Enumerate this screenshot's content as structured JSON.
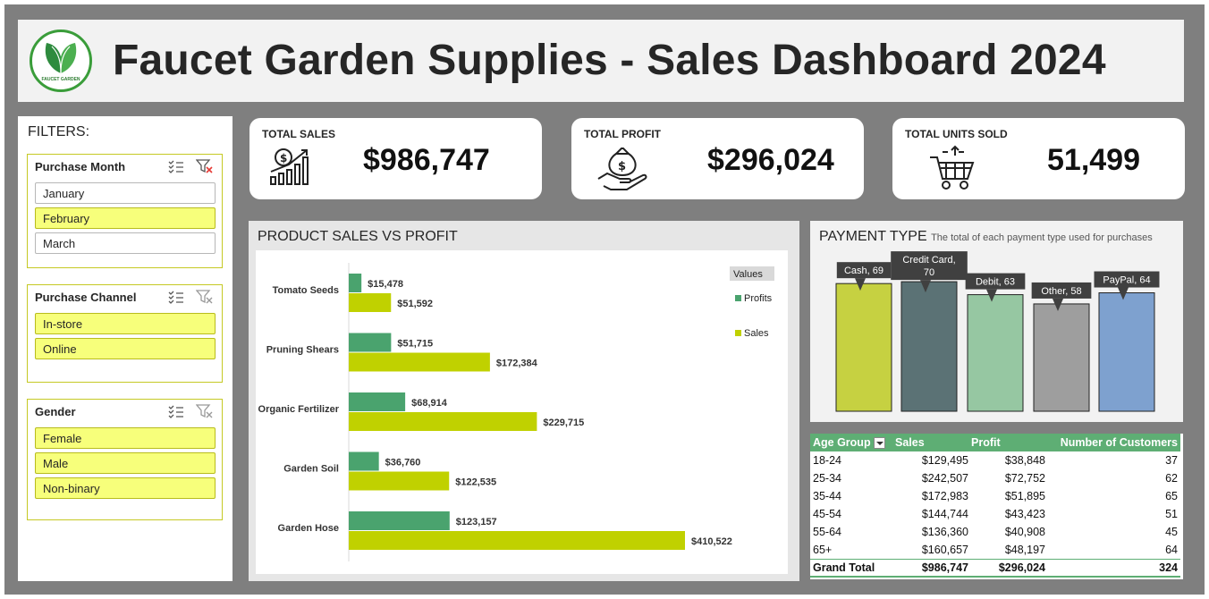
{
  "header": {
    "title": "Faucet Garden Supplies - Sales Dashboard 2024",
    "logo_text": "FAUCET GARDEN"
  },
  "filters": {
    "title": "FILTERS:",
    "slicers": [
      {
        "name": "Purchase Month",
        "items": [
          {
            "label": "January",
            "selected": false
          },
          {
            "label": "February",
            "selected": true
          },
          {
            "label": "March",
            "selected": false
          }
        ]
      },
      {
        "name": "Purchase Channel",
        "items": [
          {
            "label": "In-store",
            "selected": true
          },
          {
            "label": "Online",
            "selected": true
          }
        ]
      },
      {
        "name": "Gender",
        "items": [
          {
            "label": "Female",
            "selected": true
          },
          {
            "label": "Male",
            "selected": true
          },
          {
            "label": "Non-binary",
            "selected": true
          }
        ]
      }
    ]
  },
  "kpis": [
    {
      "label": "TOTAL SALES",
      "value": "$986,747",
      "icon": "sales-growth-icon"
    },
    {
      "label": "TOTAL PROFIT",
      "value": "$296,024",
      "icon": "money-bag-hand-icon"
    },
    {
      "label": "TOTAL UNITS SOLD",
      "value": "51,499",
      "icon": "shopping-cart-icon"
    }
  ],
  "product_chart": {
    "title": "PRODUCT SALES VS PROFIT",
    "legend_title": "Values",
    "colors": {
      "Profits": "#4aa36e",
      "Sales": "#c0d100"
    }
  },
  "payment_chart": {
    "title": "PAYMENT TYPE",
    "subtitle": "The total of each payment type used for purchases",
    "colors": [
      "#c6d141",
      "#5b7275",
      "#96c7a2",
      "#9e9e9e",
      "#7ea1cf"
    ]
  },
  "age_table": {
    "headers": [
      "Age Group",
      "Sales",
      "Profit",
      "Number of Customers"
    ],
    "rows": [
      [
        "18-24",
        "$129,495",
        "$38,848",
        "37"
      ],
      [
        "25-34",
        "$242,507",
        "$72,752",
        "62"
      ],
      [
        "35-44",
        "$172,983",
        "$51,895",
        "65"
      ],
      [
        "45-54",
        "$144,744",
        "$43,423",
        "51"
      ],
      [
        "55-64",
        "$136,360",
        "$40,908",
        "45"
      ],
      [
        "65+",
        "$160,657",
        "$48,197",
        "64"
      ]
    ],
    "total": [
      "Grand Total",
      "$986,747",
      "$296,024",
      "324"
    ]
  },
  "chart_data": [
    {
      "type": "bar",
      "orientation": "horizontal",
      "title": "PRODUCT SALES VS PROFIT",
      "categories": [
        "Tomato Seeds",
        "Pruning Shears",
        "Organic Fertilizer",
        "Garden Soil",
        "Garden Hose"
      ],
      "series": [
        {
          "name": "Profits",
          "values": [
            15478,
            51715,
            68914,
            36760,
            123157
          ],
          "labels": [
            "$15,478",
            "$51,715",
            "$68,914",
            "$36,760",
            "$123,157"
          ]
        },
        {
          "name": "Sales",
          "values": [
            51592,
            172384,
            229715,
            122535,
            410522
          ],
          "labels": [
            "$51,592",
            "$172,384",
            "$229,715",
            "$122,535",
            "$410,522"
          ]
        }
      ],
      "xlim": [
        0,
        450000
      ],
      "legend": "top-right",
      "grid": false
    },
    {
      "type": "bar",
      "title": "PAYMENT TYPE",
      "subtitle": "The total of each payment type used for purchases",
      "categories": [
        "Cash",
        "Credit Card",
        "Debit",
        "Other",
        "PayPal"
      ],
      "values": [
        69,
        70,
        63,
        58,
        64
      ],
      "labels": [
        "Cash, 69",
        "Credit Card,|70",
        "Debit, 63",
        "Other, 58",
        "PayPal, 64"
      ],
      "ylim": [
        0,
        75
      ],
      "grid": false
    }
  ]
}
